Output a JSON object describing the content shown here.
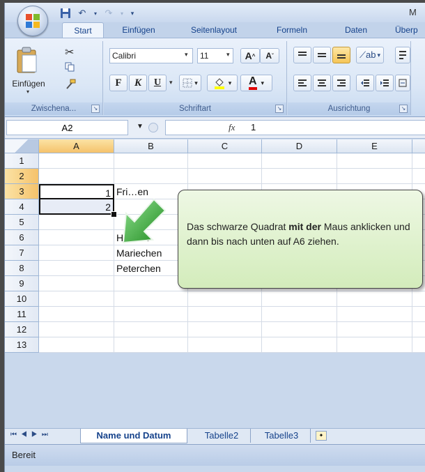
{
  "app": {
    "title_fragment": "M"
  },
  "tabs": [
    "Start",
    "Einfügen",
    "Seitenlayout",
    "Formeln",
    "Daten",
    "Überp"
  ],
  "ribbon": {
    "clipboard": {
      "paste_label": "Einfügen",
      "group_label": "Zwischena..."
    },
    "font": {
      "font_name": "Calibri",
      "font_size": "11",
      "bold": "F",
      "italic": "K",
      "underline": "U",
      "grow": "A",
      "shrink": "A",
      "font_color": "A",
      "group_label": "Schriftart"
    },
    "alignment": {
      "group_label": "Ausrichtung"
    }
  },
  "formula_bar": {
    "name_box": "A2",
    "fx": "fx",
    "value": "1"
  },
  "columns": [
    "A",
    "B",
    "C",
    "D",
    "E"
  ],
  "rows": [
    "1",
    "2",
    "3",
    "4",
    "5",
    "6",
    "7",
    "8",
    "9",
    "10",
    "11",
    "12",
    "13"
  ],
  "cells": {
    "A2": "1",
    "A3": "2",
    "B2": "Fri…en",
    "B4": "Herbert",
    "B5": "Mariechen",
    "B6": "Peterchen"
  },
  "callout": {
    "text_1": "Das schwarze Quadrat ",
    "text_bold": "mit der",
    "text_2": " Maus anklicken und dann bis nach unten auf A6 ziehen."
  },
  "sheet_tabs": [
    "Name und Datum",
    "Tabelle2",
    "Tabelle3"
  ],
  "status": {
    "text": "Bereit"
  },
  "colors": {
    "selection_orange": "#f5c26b",
    "arrow_green": "#3aa63a",
    "callout_bg": "#d3ecbb"
  }
}
